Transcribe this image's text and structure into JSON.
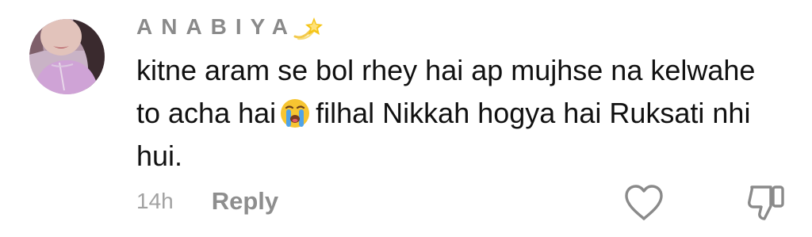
{
  "comment": {
    "username": "ANABIYA",
    "username_badge_icon": "dizzy-icon",
    "text_part1": "kitne aram se bol rhey hai ap mujhse na kelwahe to acha hai",
    "emoji": "loudly-crying-face-icon",
    "text_part2": "filhal Nikkah hogya hai Ruksati nhi hui.",
    "timestamp": "14h",
    "reply_label": "Reply",
    "like_icon": "heart-outline-icon",
    "dislike_icon": "thumbs-down-outline-icon"
  },
  "colors": {
    "username": "#8a8a8a",
    "text": "#111111",
    "meta": "#a2a2a2",
    "icon_stroke": "#8a8a8a",
    "avatar_bg": "#c7a6c9"
  }
}
